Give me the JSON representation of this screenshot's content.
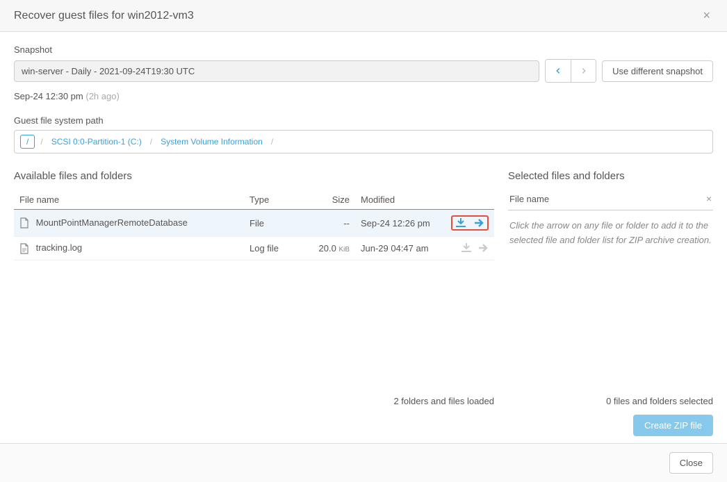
{
  "header": {
    "title": "Recover guest files for win2012-vm3"
  },
  "snapshot": {
    "label": "Snapshot",
    "value": "win-server - Daily - 2021-09-24T19:30 UTC",
    "use_different": "Use different snapshot",
    "time": "Sep-24 12:30 pm",
    "ago": "(2h ago)"
  },
  "path": {
    "label": "Guest file system path",
    "crumbs": [
      "/",
      "SCSI 0:0-Partition-1 (C:)",
      "System Volume Information"
    ]
  },
  "available": {
    "title": "Available files and folders",
    "columns": {
      "name": "File name",
      "type": "Type",
      "size": "Size",
      "modified": "Modified"
    },
    "rows": [
      {
        "name": "MountPointManagerRemoteDatabase",
        "type": "File",
        "size": "--",
        "unit": "",
        "modified": "Sep-24 12:26 pm",
        "active": true
      },
      {
        "name": "tracking.log",
        "type": "Log file",
        "size": "20.0",
        "unit": "KiB",
        "modified": "Jun-29 04:47 am",
        "active": false
      }
    ],
    "status": "2 folders and files loaded"
  },
  "selected": {
    "title": "Selected files and folders",
    "column": "File name",
    "hint": "Click the arrow on any file or folder to add it to the selected file and folder list for ZIP archive creation.",
    "status": "0 files and folders selected",
    "create_zip": "Create ZIP file"
  },
  "footer": {
    "close": "Close"
  },
  "colors": {
    "link": "#3ba0d8",
    "highlight": "#e74c3c"
  }
}
